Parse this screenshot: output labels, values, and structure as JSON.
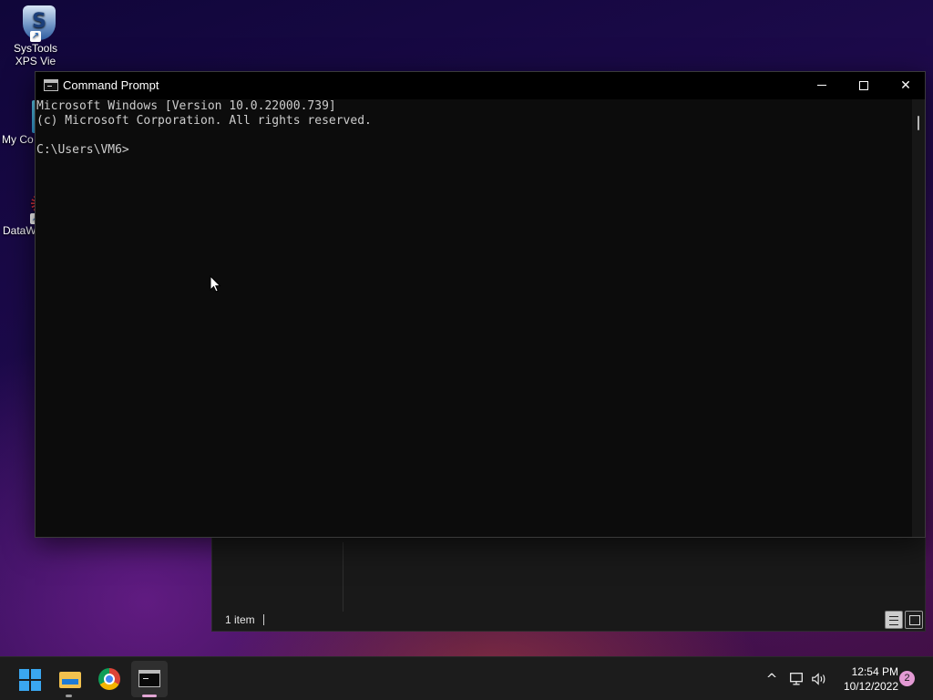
{
  "desktop": {
    "icons": [
      {
        "label": "SysTools XPS Vie",
        "icon": "systools-xps-viewer-icon"
      },
      {
        "label": "My Co",
        "icon": "my-computer-icon"
      },
      {
        "label": "DataW",
        "icon": "datawrapper-icon"
      }
    ]
  },
  "cmd_window": {
    "title": "Command Prompt",
    "minimize_glyph": "",
    "maximize_glyph": "",
    "close_glyph": "✕",
    "console_lines": [
      "Microsoft Windows [Version 10.0.22000.739]",
      "(c) Microsoft Corporation. All rights reserved.",
      "",
      "C:\\Users\\VM6>"
    ]
  },
  "explorer_window": {
    "status_text": "1 item"
  },
  "taskbar": {
    "apps": [
      "start",
      "file-explorer",
      "chrome",
      "command-prompt"
    ],
    "tray": {
      "chevron": "^",
      "network": "🖵",
      "volume": "🔊",
      "time": "12:54 PM",
      "date": "10/12/2022",
      "notification_count": "2"
    }
  },
  "colors": {
    "console_bg": "#0c0c0c",
    "console_text": "#cccccc",
    "accent": "#3aa7f0",
    "badge": "#e39ad4"
  }
}
